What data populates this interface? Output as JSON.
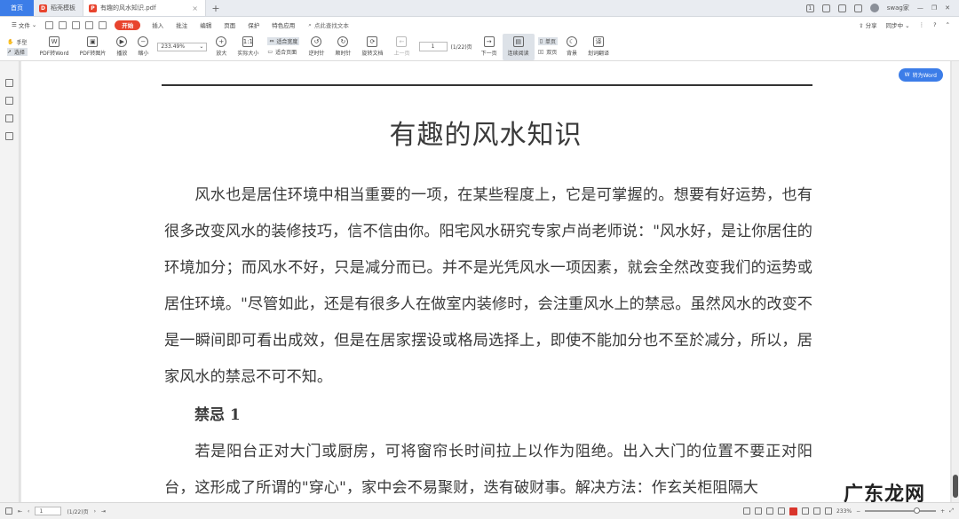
{
  "tabs": {
    "home": "首页",
    "items": [
      {
        "label": "稻壳模板",
        "active": false
      },
      {
        "label": "有趣的风水知识.pdf",
        "active": true
      }
    ],
    "user": "swag家"
  },
  "menu": {
    "file": "文件",
    "start": "开始",
    "items": [
      "插入",
      "批注",
      "编辑",
      "页面",
      "保护",
      "特色应用"
    ],
    "search_placeholder": "点此查找文本",
    "share": "分享",
    "sync": "同步中"
  },
  "ribbon": {
    "hand": "手型",
    "select": "选择",
    "pdf_to_word": "PDF转Word",
    "pdf_to_image": "PDF转图片",
    "play": "播放",
    "zoom_out": "缩小",
    "zoom_value": "233.49%",
    "zoom_in": "放大",
    "actual_size": "实际大小",
    "fit_width": "适合宽度",
    "fit_page": "适合页面",
    "rotate_ccw": "逆时针",
    "rotate_cw": "顺时针",
    "rotate_doc": "旋转文档",
    "prev_page": "上一页",
    "page_value": "1",
    "page_total": "(1/22)页",
    "next_page": "下一页",
    "continuous": "连续阅读",
    "single": "单页",
    "double": "双页",
    "background": "背景",
    "translate": "划词翻译"
  },
  "document": {
    "to_word": "转为Word",
    "title": "有趣的风水知识",
    "para1": "风水也是居住环境中相当重要的一项，在某些程度上，它是可掌握的。想要有好运势，也有很多改变风水的装修技巧，信不信由你。阳宅风水研究专家卢尚老师说：\"风水好，是让你居住的环境加分；而风水不好，只是减分而已。并不是光凭风水一项因素，就会全然改变我们的运势或居住环境。\"尽管如此，还是有很多人在做室内装修时，会注重风水上的禁忌。虽然风水的改变不是一瞬间即可看出成效，但是在居家摆设或格局选择上，即使不能加分也不至於减分，所以，居家风水的禁忌不可不知。",
    "heading1": "禁忌 1",
    "para2": "若是阳台正对大门或厨房，可将窗帘长时间拉上以作为阻绝。出入大门的位置不要正对阳台，这形成了所谓的\"穿心\"，家中会不易聚财，迭有破财事。解决方法：作玄关柜阻隔大",
    "watermark": "广东龙网"
  },
  "status": {
    "page_value": "1",
    "page_total": "(1/22)页",
    "zoom": "233%"
  }
}
